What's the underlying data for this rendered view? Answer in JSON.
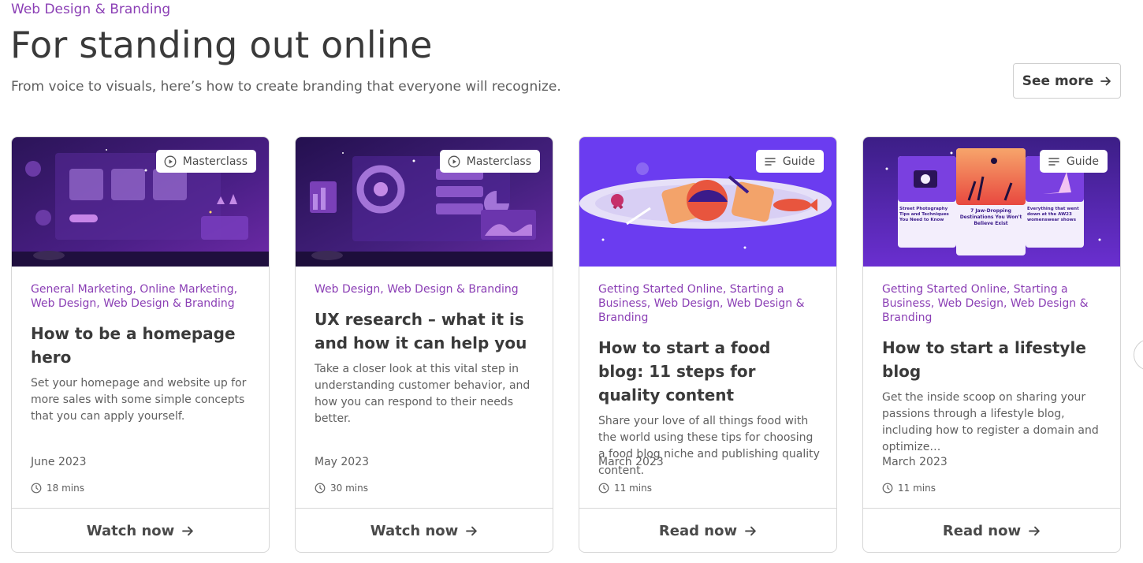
{
  "section": {
    "eyebrow": "Web Design & Branding",
    "title": "For standing out online",
    "subtitle": "From voice to visuals, here’s how to create branding that everyone will recognize.",
    "see_more": "See more"
  },
  "cards": [
    {
      "badge": "Masterclass",
      "badge_icon": "play-icon",
      "categories": "General Marketing, Online Marketing, Web Design, Web Design & Branding",
      "title": "How to be a homepage hero",
      "description": "Set your homepage and website up for more sales with some simple concepts that you can apply yourself.",
      "date": "June 2023",
      "time": "18 mins",
      "cta": "Watch now"
    },
    {
      "badge": "Masterclass",
      "badge_icon": "play-icon",
      "categories": "Web Design, Web Design & Branding",
      "title": "UX research – what it is and how it can help you",
      "description": "Take a closer look at this vital step in understanding customer behavior, and how you can respond to their needs better.",
      "date": "May 2023",
      "time": "30 mins",
      "cta": "Watch now"
    },
    {
      "badge": "Guide",
      "badge_icon": "menu-lines-icon",
      "categories": "Getting Started Online, Starting a Business, Web Design, Web Design & Branding",
      "title": "How to start a food blog: 11 steps for quality content",
      "description": "Share your love of all things food with the world using these tips for choosing a food blog niche and publishing quality content.",
      "date": "March 2023",
      "time": "11 mins",
      "cta": "Read now"
    },
    {
      "badge": "Guide",
      "badge_icon": "menu-lines-icon",
      "categories": "Getting Started Online, Starting a Business, Web Design, Web Design & Branding",
      "title": "How to start a lifestyle blog",
      "description": "Get the inside scoop on sharing your passions through a lifestyle blog, including how to register a domain and optimize…",
      "date": "March 2023",
      "time": "11 mins",
      "cta": "Read now",
      "image_text": {
        "post1": "Street Photography Tips and Techniques You Need to Know",
        "post2": "7 Jaw-Dropping Destinations You Won't Believe Exist",
        "post3": "Everything that went down at the AW23 womenswear shows"
      }
    }
  ],
  "colors": {
    "accent": "#8b3fb5",
    "hero_purple": "#6b3cf0",
    "night": "#2a1452"
  }
}
